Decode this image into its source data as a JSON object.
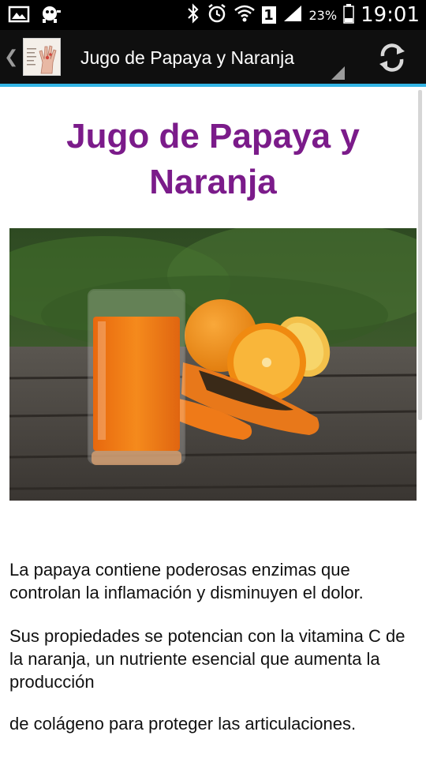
{
  "status_bar": {
    "battery_percent": "23%",
    "time": "19:01",
    "sim_slot": "1",
    "icons": [
      "gallery-icon",
      "pet-icon",
      "bluetooth-icon",
      "alarm-icon",
      "wifi-icon",
      "sim-icon",
      "signal-icon",
      "battery-icon"
    ]
  },
  "action_bar": {
    "title": "Jugo de Papaya y Naranja",
    "icons": [
      "up-chevron-icon",
      "app-logo-icon",
      "spinner-indicator-icon",
      "refresh-icon"
    ],
    "accent_color": "#33b5e5"
  },
  "article": {
    "title": "Jugo de Papaya y Naranja",
    "title_color": "#7b1b8a",
    "image": "juice-with-papaya-and-oranges",
    "paragraph1": "La papaya contiene poderosas enzimas que controlan la inflamación y disminuyen el dolor.",
    "paragraph2": "Sus propiedades se potencian con la vitamina C de la naranja, un nutriente esencial que aumenta la producción",
    "paragraph3": "de colágeno para proteger las articulaciones."
  }
}
